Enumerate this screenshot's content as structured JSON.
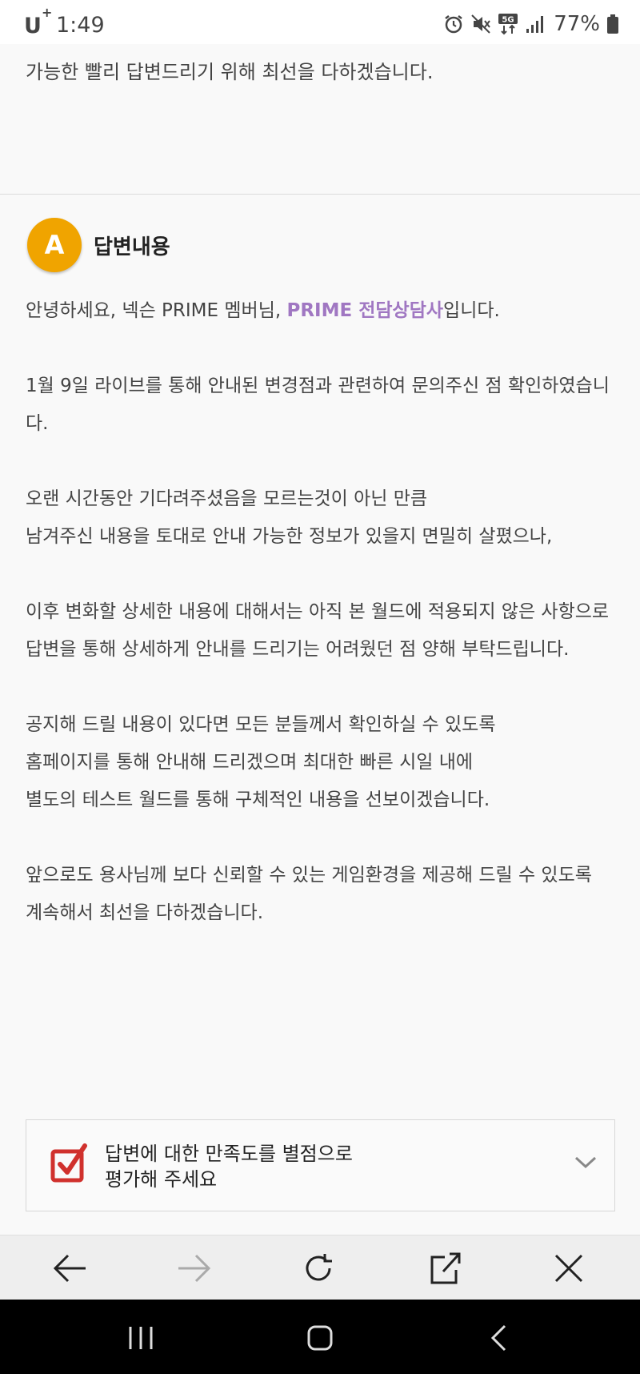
{
  "status_bar": {
    "carrier": "U",
    "carrier_sup": "+",
    "time": "1:49",
    "battery": "77%"
  },
  "question_tail": "가능한 빨리 답변드리기 위해 최선을 다하겠습니다.",
  "answer": {
    "badge": "A",
    "title": "답변내용",
    "greeting_pre": "안녕하세요, 넥슨 PRIME 멤버님, ",
    "greeting_highlight": "PRIME 전담상담사",
    "greeting_post": "입니다.",
    "lines": [
      "1월 9일 라이브를 통해 안내된 변경점과 관련하여 문의주신 점 확인하였습니다.",
      "오랜 시간동안 기다려주셨음을 모르는것이 아닌 만큼",
      "남겨주신 내용을 토대로 안내 가능한 정보가 있을지 면밀히 살폈으나,",
      "이후 변화할 상세한 내용에 대해서는 아직 본 월드에 적용되지 않은 사항으로",
      "답변을 통해 상세하게 안내를 드리기는 어려웠던 점 양해 부탁드립니다.",
      "공지해 드릴 내용이 있다면 모든 분들께서 확인하실 수 있도록",
      "홈페이지를 통해 안내해 드리겠으며 최대한 빠른 시일 내에",
      "별도의 테스트 월드를 통해 구체적인 내용을 선보이겠습니다.",
      "앞으로도 용사님께 보다 신뢰할 수 있는 게임환경을 제공해 드릴 수 있도록",
      "계속해서 최선을 다하겠습니다."
    ]
  },
  "rating": {
    "line1": "답변에 대한 만족도를 별점으로",
    "line2": "평가해 주세요"
  },
  "colors": {
    "badge": "#f0a400",
    "highlight": "#a077c2",
    "check": "#d0312d"
  }
}
